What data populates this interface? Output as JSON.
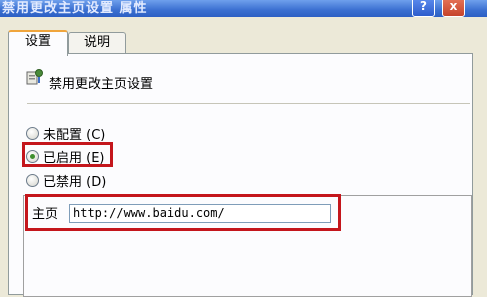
{
  "window": {
    "title": "禁用更改主页设置 属性",
    "help_glyph": "?",
    "close_glyph": "x"
  },
  "tabs": [
    {
      "label": "设置",
      "active": true
    },
    {
      "label": "说明",
      "active": false
    }
  ],
  "policy": {
    "icon": "policy-setting-icon",
    "title": "禁用更改主页设置"
  },
  "options": [
    {
      "label": "未配置 (C)",
      "checked": false
    },
    {
      "label": "已启用 (E)",
      "checked": true
    },
    {
      "label": "已禁用 (D)",
      "checked": false
    }
  ],
  "homepage": {
    "label": "主页",
    "value": "http://www.baidu.com/"
  },
  "colors": {
    "highlight": "#c4161c",
    "title_bar": "#3a6fd0",
    "dialog_bg": "#ece9d8"
  }
}
